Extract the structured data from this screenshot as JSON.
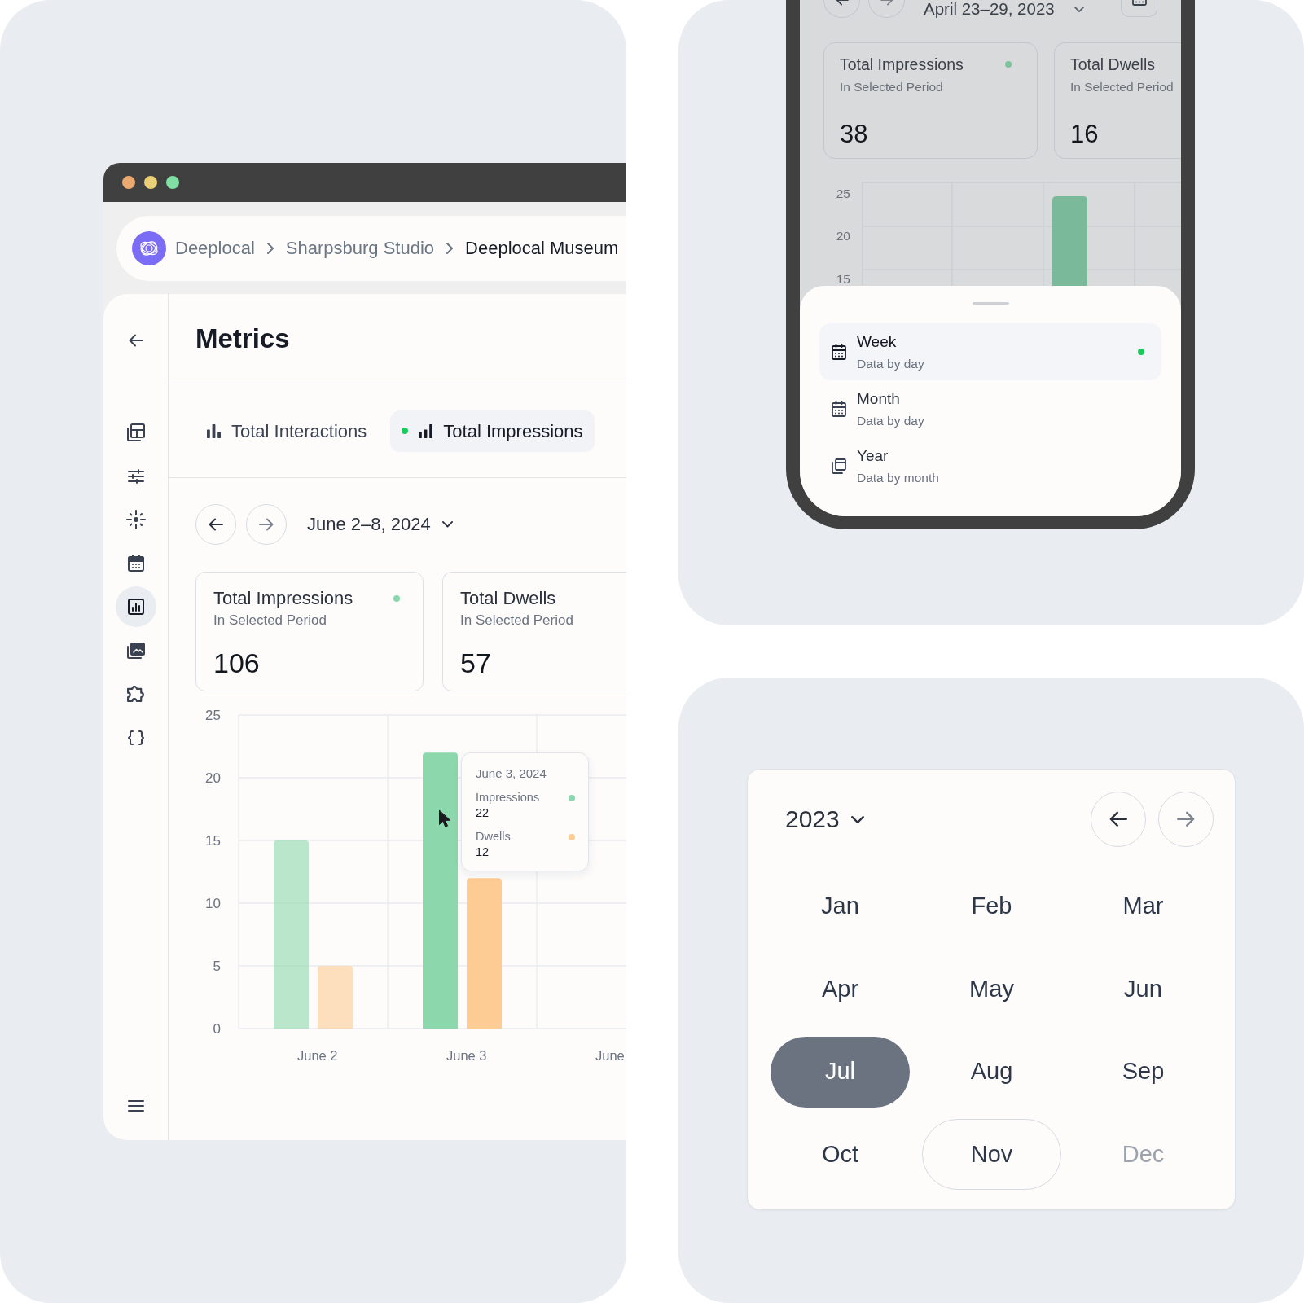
{
  "metrics_window": {
    "breadcrumb": [
      {
        "label": "Deeplocal",
        "current": false
      },
      {
        "label": "Sharpsburg Studio",
        "current": false
      },
      {
        "label": "Deeplocal Museum",
        "current": true
      }
    ],
    "sidebar": {
      "items": [
        {
          "selected": false
        },
        {
          "selected": false
        },
        {
          "selected": false
        },
        {
          "selected": false
        },
        {
          "selected": true
        },
        {
          "selected": false
        },
        {
          "selected": false
        },
        {
          "selected": false
        }
      ]
    },
    "title": "Metrics",
    "tabs": [
      {
        "label": "Total Interactions",
        "selected": false
      },
      {
        "label": "Total Impressions",
        "selected": true
      }
    ],
    "date_range": "June 2–8, 2024",
    "stat_cards": [
      {
        "title": "Total Impressions",
        "subtitle": "In Selected Period",
        "value": "106",
        "selected": true
      },
      {
        "title": "Total Dwells",
        "subtitle": "In Selected Period",
        "value": "57",
        "selected": false
      }
    ],
    "chart": {
      "chart_data": {
        "type": "bar",
        "categories": [
          "June 2",
          "June 3",
          "June"
        ],
        "series": [
          {
            "name": "Impressions",
            "color": "#8dd7ac",
            "values": [
              15,
              22,
              null
            ]
          },
          {
            "name": "Dwells",
            "color": "#fdcb94",
            "values": [
              5,
              12,
              null
            ]
          }
        ],
        "ylim": [
          0,
          25
        ],
        "yticks": [
          0,
          5,
          10,
          15,
          20,
          25
        ],
        "grid": true
      },
      "x_categories": [
        {
          "hovered": false
        },
        {
          "hovered": true
        },
        {
          "hovered": false
        }
      ],
      "tooltip": {
        "title": "June 3, 2024",
        "items": [
          {
            "value": "22"
          },
          {
            "value": "12"
          }
        ]
      }
    }
  },
  "phone": {
    "date_range": "April 23–29, 2023",
    "stat_cards": [
      {
        "title": "Total Impressions",
        "subtitle": "In Selected Period",
        "value": "38",
        "selected": true
      },
      {
        "title": "Total Dwells",
        "subtitle": "In Selected Period",
        "value": "16",
        "selected": false
      }
    ],
    "chart": {
      "y_labels": [
        "25",
        "20",
        "15"
      ]
    },
    "period_sheet": {
      "options": [
        {
          "label": "Week",
          "description": "Data by day",
          "selected": true
        },
        {
          "label": "Month",
          "description": "Data by day",
          "selected": false
        },
        {
          "label": "Year",
          "description": "Data by month",
          "selected": false
        }
      ]
    }
  },
  "month_picker": {
    "year": "2023",
    "months": [
      {
        "label": "Jan",
        "selected": false,
        "current": false,
        "disabled": false
      },
      {
        "label": "Feb",
        "selected": false,
        "current": false,
        "disabled": false
      },
      {
        "label": "Mar",
        "selected": false,
        "current": false,
        "disabled": false
      },
      {
        "label": "Apr",
        "selected": false,
        "current": false,
        "disabled": false
      },
      {
        "label": "May",
        "selected": false,
        "current": false,
        "disabled": false
      },
      {
        "label": "Jun",
        "selected": false,
        "current": false,
        "disabled": false
      },
      {
        "label": "Jul",
        "selected": true,
        "current": false,
        "disabled": false
      },
      {
        "label": "Aug",
        "selected": false,
        "current": false,
        "disabled": false
      },
      {
        "label": "Sep",
        "selected": false,
        "current": false,
        "disabled": false
      },
      {
        "label": "Oct",
        "selected": false,
        "current": false,
        "disabled": false
      },
      {
        "label": "Nov",
        "selected": false,
        "current": true,
        "disabled": false
      },
      {
        "label": "Dec",
        "selected": false,
        "current": false,
        "disabled": true
      }
    ]
  }
}
